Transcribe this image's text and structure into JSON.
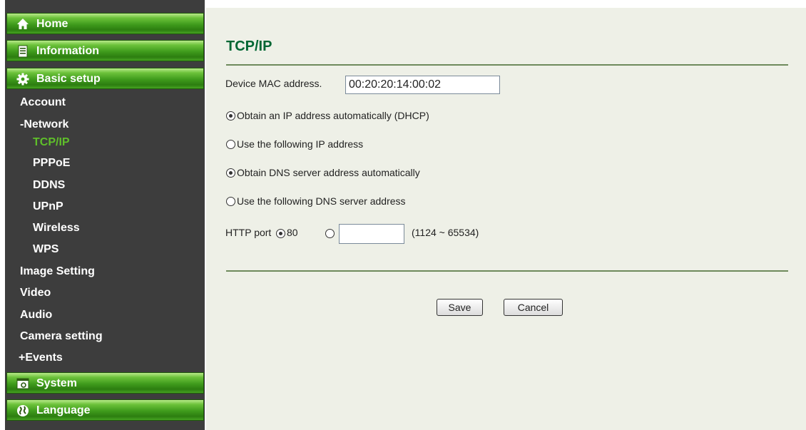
{
  "sidebar": {
    "home": "Home",
    "information": "Information",
    "basic_setup": "Basic setup",
    "items": {
      "account": "Account",
      "network": "-Network",
      "tcpip": "TCP/IP",
      "pppoe": "PPPoE",
      "ddns": "DDNS",
      "upnp": "UPnP",
      "wireless": "Wireless",
      "wps": "WPS",
      "image_setting": "Image Setting",
      "video": "Video",
      "audio": "Audio",
      "camera_setting": "Camera setting",
      "events": "+Events"
    },
    "system": "System",
    "language": "Language"
  },
  "main": {
    "title": "TCP/IP",
    "mac_label": "Device MAC address.",
    "mac_value": "00:20:20:14:00:02",
    "options": {
      "dhcp": "Obtain an IP address automatically (DHCP)",
      "static_ip": "Use the following IP address",
      "dns_auto": "Obtain DNS server address automatically",
      "dns_manual": "Use the following DNS server address"
    },
    "selected": {
      "ip_mode": "dhcp",
      "dns_mode": "auto",
      "http_port_mode": "default"
    },
    "http": {
      "label": "HTTP port",
      "default_port": "80",
      "custom_value": "",
      "range": "(1124 ~ 65534)"
    },
    "buttons": {
      "save": "Save",
      "cancel": "Cancel"
    }
  },
  "icons": {
    "home": "home-icon",
    "information": "document-icon",
    "basic_setup": "gear-icon",
    "system": "system-window-icon",
    "language": "globe-icon"
  },
  "colors": {
    "sidebar_bg": "#3d3d3d",
    "header_green": "#3f9b1c",
    "active_item": "#5fbf2a",
    "content_bg": "#eef0e7",
    "title": "#006633",
    "divider": "#6e8a5c"
  }
}
